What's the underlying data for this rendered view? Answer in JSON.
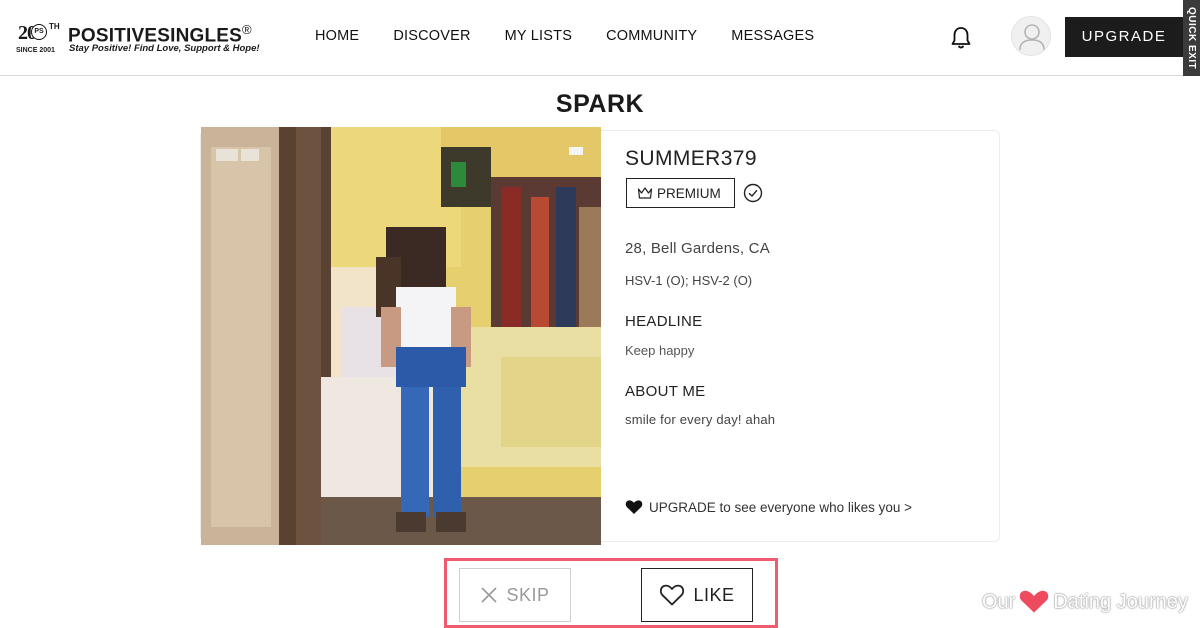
{
  "header": {
    "logo": {
      "anniversary": "20",
      "anniversary_suffix": "TH",
      "badge": "PS",
      "since": "SINCE 2001",
      "name": "POSITIVESINGLES",
      "registered": "®",
      "tagline": "Stay Positive! Find Love, Support & Hope!"
    },
    "nav": [
      "HOME",
      "DISCOVER",
      "MY LISTS",
      "COMMUNITY",
      "MESSAGES"
    ],
    "upgrade_label": "UPGRADE",
    "quick_exit_label": "QUICK EXIT"
  },
  "page": {
    "title": "SPARK"
  },
  "profile": {
    "username": "SUMMER379",
    "badge_label": "PREMIUM",
    "location": "28, Bell Gardens, CA",
    "status": "HSV-1 (O); HSV-2 (O)",
    "headline_label": "HEADLINE",
    "headline": "Keep happy",
    "about_label": "ABOUT ME",
    "about": "smile for every day!  ahah",
    "upsell": "UPGRADE to see everyone who likes you >"
  },
  "actions": {
    "skip_label": "SKIP",
    "like_label": "LIKE"
  },
  "watermark": {
    "left": "Our",
    "right": "Dating Journey"
  },
  "colors": {
    "accent_dark": "#1c1c1c",
    "highlight": "#ef5c70",
    "watermark_heart": "#ef4b5f"
  }
}
